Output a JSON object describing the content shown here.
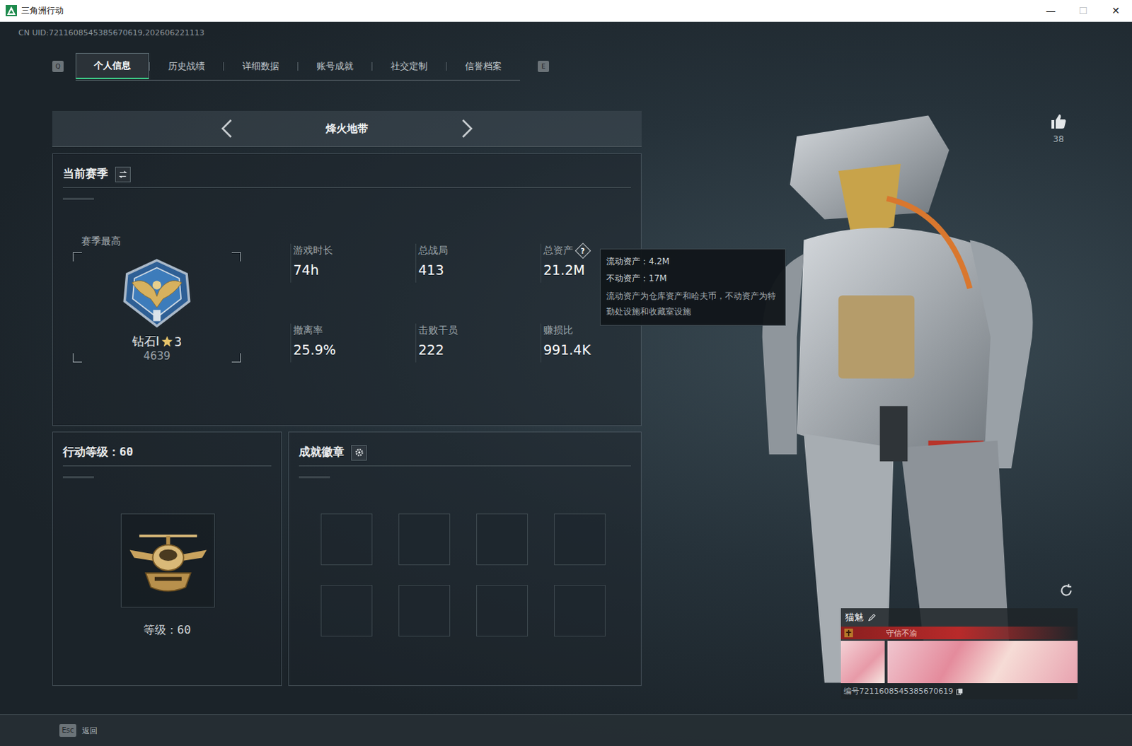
{
  "window": {
    "title": "三角洲行动",
    "controls": [
      {
        "glyph": "—",
        "disabled": false
      },
      {
        "glyph": "☐",
        "disabled": true
      },
      {
        "glyph": "✕",
        "disabled": false
      }
    ]
  },
  "uid": "CN UID:7211608545385670619,202606221113",
  "tabs": {
    "prev_key": "Q",
    "next_key": "E",
    "items": [
      {
        "label": "个人信息",
        "selected": true
      },
      {
        "label": "历史战绩",
        "selected": false
      },
      {
        "label": "详细数据",
        "selected": false
      },
      {
        "label": "账号成就",
        "selected": false
      },
      {
        "label": "社交定制",
        "selected": false
      },
      {
        "label": "信誉档案",
        "selected": false
      }
    ]
  },
  "mode": {
    "label": "烽火地带"
  },
  "season": {
    "title": "当前赛季",
    "best_label": "赛季最高",
    "rank": "钻石I",
    "stars": "3",
    "score": "4639",
    "stats": [
      {
        "label": "游戏时长",
        "value": "74h",
        "help": ""
      },
      {
        "label": "总战局",
        "value": "413",
        "help": ""
      },
      {
        "label": "总资产",
        "value": "21.2M",
        "help": "?"
      },
      {
        "label": "撤离率",
        "value": "25.9%",
        "help": ""
      },
      {
        "label": "击败干员",
        "value": "222",
        "help": ""
      },
      {
        "label": "赚损比",
        "value": "991.4K",
        "help": ""
      }
    ]
  },
  "tooltip": {
    "lines": [
      "流动资产：4.2M",
      "不动资产：17M"
    ],
    "note": "流动资产为仓库资产和哈夫币，不动资产为特勤处设施和收藏室设施"
  },
  "level": {
    "title": "行动等级：60",
    "caption": "等级：60"
  },
  "badges": {
    "title": "成就徽章",
    "slots": [
      {
        "filled": false
      },
      {
        "filled": false
      },
      {
        "filled": false
      },
      {
        "filled": false
      },
      {
        "filled": false
      },
      {
        "filled": false
      },
      {
        "filled": false
      },
      {
        "filled": false
      }
    ]
  },
  "likes": {
    "count": "38"
  },
  "player": {
    "name": "猫魅",
    "tag": "守信不渝",
    "id": "编号7211608545385670619"
  },
  "footer": {
    "key": "Esc",
    "label": "返回"
  }
}
